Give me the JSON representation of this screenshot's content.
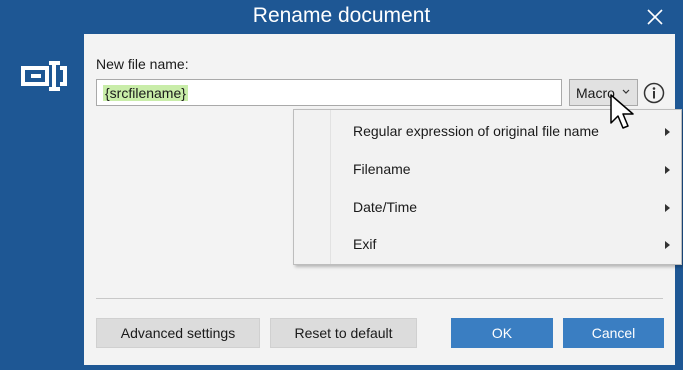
{
  "window": {
    "title": "Rename document"
  },
  "icons": {
    "close": "close-icon",
    "rename": "rename-field-icon",
    "info": "info-icon",
    "chevron": "chevron-down-icon",
    "submenu": "chevron-right-icon",
    "cursor": "mouse-pointer-icon"
  },
  "form": {
    "label": "New file name:",
    "value": "{srcfilename}",
    "macro_button": "Macro"
  },
  "macro_menu": {
    "items": [
      {
        "label": "Regular expression of original file name"
      },
      {
        "label": "Filename"
      },
      {
        "label": "Date/Time"
      },
      {
        "label": "Exif"
      }
    ]
  },
  "footer": {
    "advanced": "Advanced settings",
    "reset": "Reset to default",
    "ok": "OK",
    "cancel": "Cancel"
  },
  "colors": {
    "chrome": "#1e5794",
    "accent": "#3a7ec2",
    "token_highlight": "#c9eda9"
  }
}
